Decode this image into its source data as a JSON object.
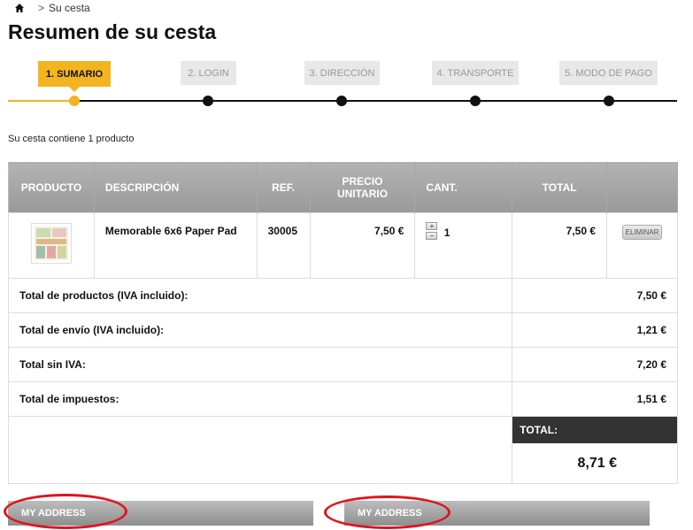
{
  "breadcrumb": {
    "separator": ">",
    "current": "Su cesta"
  },
  "page_title": "Resumen de su cesta",
  "steps": [
    {
      "label": "1. SUMARIO",
      "active": true
    },
    {
      "label": "2. LOGIN",
      "active": false
    },
    {
      "label": "3. DIRECCIÓN",
      "active": false
    },
    {
      "label": "4. TRANSPORTE",
      "active": false
    },
    {
      "label": "5. MODO DE PAGO",
      "active": false
    }
  ],
  "cart_summary": "Su cesta contiene 1 producto",
  "table": {
    "headers": {
      "product": "PRODUCTO",
      "description": "DESCRIPCIÓN",
      "ref": "REF.",
      "unit_price_line1": "PRECIO",
      "unit_price_line2": "UNITARIO",
      "qty": "CANT.",
      "total": "TOTAL"
    },
    "items": [
      {
        "description": "Memorable 6x6 Paper Pad",
        "ref": "30005",
        "unit_price": "7,50 €",
        "qty_increase": "+",
        "qty_decrease": "−",
        "qty": "1",
        "total": "7,50 €",
        "delete_label": "ELIMINAR"
      }
    ],
    "summary": [
      {
        "label": "Total de productos (IVA incluido):",
        "value": "7,50 €"
      },
      {
        "label": "Total de envío (IVA incluido):",
        "value": "1,21 €"
      },
      {
        "label": "Total sin IVA:",
        "value": "7,20 €"
      },
      {
        "label": "Total de impuestos:",
        "value": "1,51 €"
      }
    ],
    "grand_total_label": "TOTAL:",
    "grand_total_value": "8,71 €"
  },
  "addresses": [
    {
      "label": "MY ADDRESS"
    },
    {
      "label": "MY ADDRESS"
    }
  ],
  "colors": {
    "accent": "#f2b51f",
    "header_gray": "#a6a6a6",
    "annotation_red": "#e0141e"
  }
}
